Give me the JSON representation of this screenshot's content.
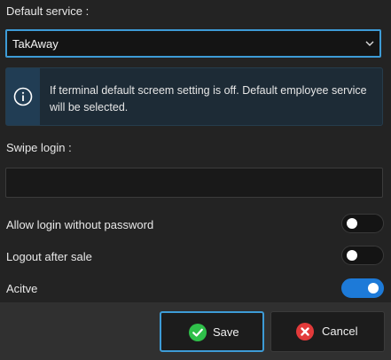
{
  "default_service": {
    "label": "Default service :",
    "selected": "TakAway"
  },
  "info": {
    "icon": "info-circle-icon",
    "message": "If terminal default screem setting is off. Default employee service will be selected."
  },
  "swipe_login": {
    "label": "Swipe login :",
    "value": ""
  },
  "toggles": [
    {
      "label": "Allow login without password",
      "on": false
    },
    {
      "label": "Logout after sale",
      "on": false
    },
    {
      "label": "Acitve",
      "on": true
    }
  ],
  "buttons": {
    "save_label": "Save",
    "save_icon": "check-circle-icon",
    "cancel_label": "Cancel",
    "cancel_icon": "x-circle-icon"
  },
  "colors": {
    "accent": "#3d9bd6",
    "toggle_on": "#1d7ad8",
    "save_icon": "#2fc04a",
    "cancel_icon": "#e23a3a"
  }
}
